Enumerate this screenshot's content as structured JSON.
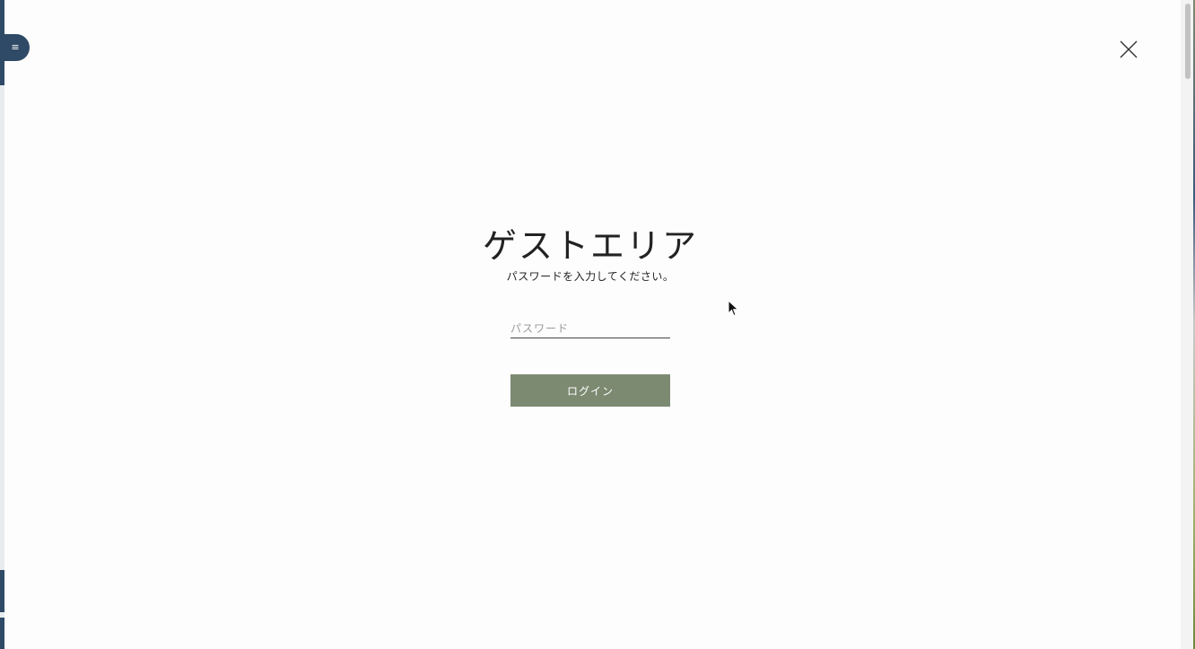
{
  "menu": {
    "icon": "menu-lines-icon",
    "glyph": "≡"
  },
  "modal": {
    "close_icon": "close-x-icon",
    "title": "ゲストエリア",
    "subtitle": "パスワードを入力してください。",
    "password": {
      "value": "",
      "placeholder": "パスワード"
    },
    "login_label": "ログイン"
  },
  "colors": {
    "accent": "#7d8a72",
    "menu_tab": "#2f4a66",
    "background": "#fdfdfd",
    "text": "#222222"
  }
}
